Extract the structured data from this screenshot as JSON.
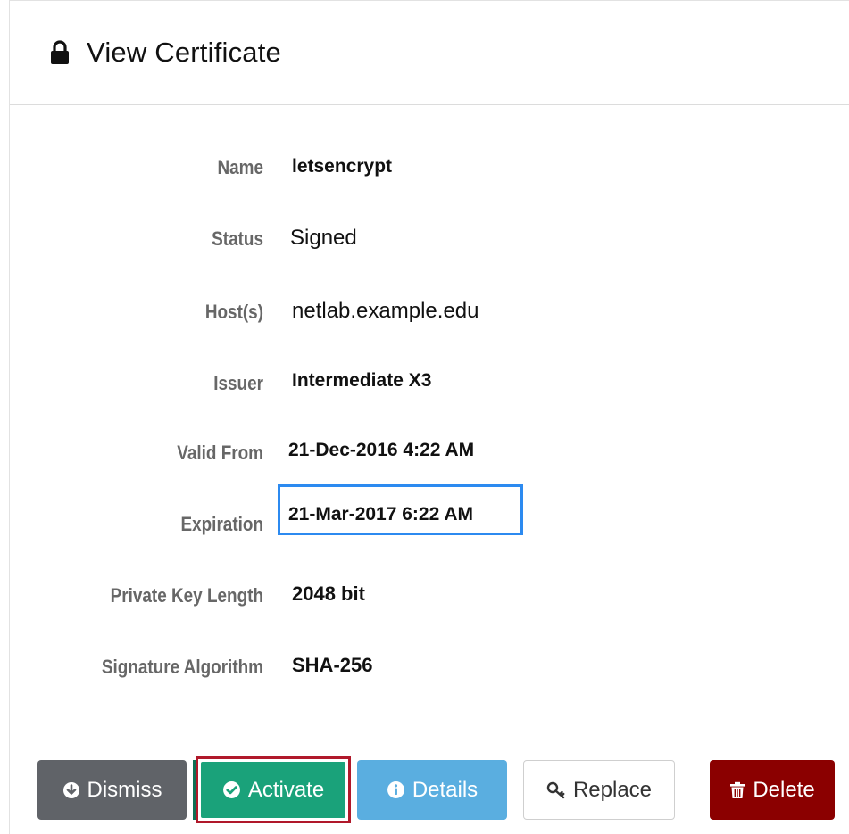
{
  "header": {
    "title": "View Certificate"
  },
  "fields": {
    "name": {
      "label": "Name",
      "value": "letsencrypt"
    },
    "status": {
      "label": "Status",
      "value": "Signed"
    },
    "hosts": {
      "label": "Host(s)",
      "value": "netlab.example.edu"
    },
    "issuer": {
      "label": "Issuer",
      "value": "Intermediate X3"
    },
    "valid_from": {
      "label": "Valid From",
      "value": "21-Dec-2016 4:22 AM"
    },
    "expiration": {
      "label": "Expiration",
      "value": "21-Mar-2017 6:22 AM"
    },
    "key_length": {
      "label": "Private Key Length",
      "value": "2048 bit"
    },
    "signature": {
      "label": "Signature Algorithm",
      "value": "SHA-256"
    }
  },
  "actions": {
    "dismiss": "Dismiss",
    "activate": "Activate",
    "details": "Details",
    "replace": "Replace",
    "delete": "Delete"
  },
  "icons": {
    "header": "lock-icon",
    "dismiss": "arrow-down-circle-icon",
    "activate": "check-circle-icon",
    "details": "info-circle-icon",
    "replace": "key-icon",
    "delete": "trash-icon"
  },
  "colors": {
    "dismiss": "#606368",
    "activate": "#1aa27a",
    "details": "#5aaee0",
    "delete": "#8b0000",
    "highlight_blue": "#2c8af0",
    "highlight_red": "#b0182a"
  }
}
